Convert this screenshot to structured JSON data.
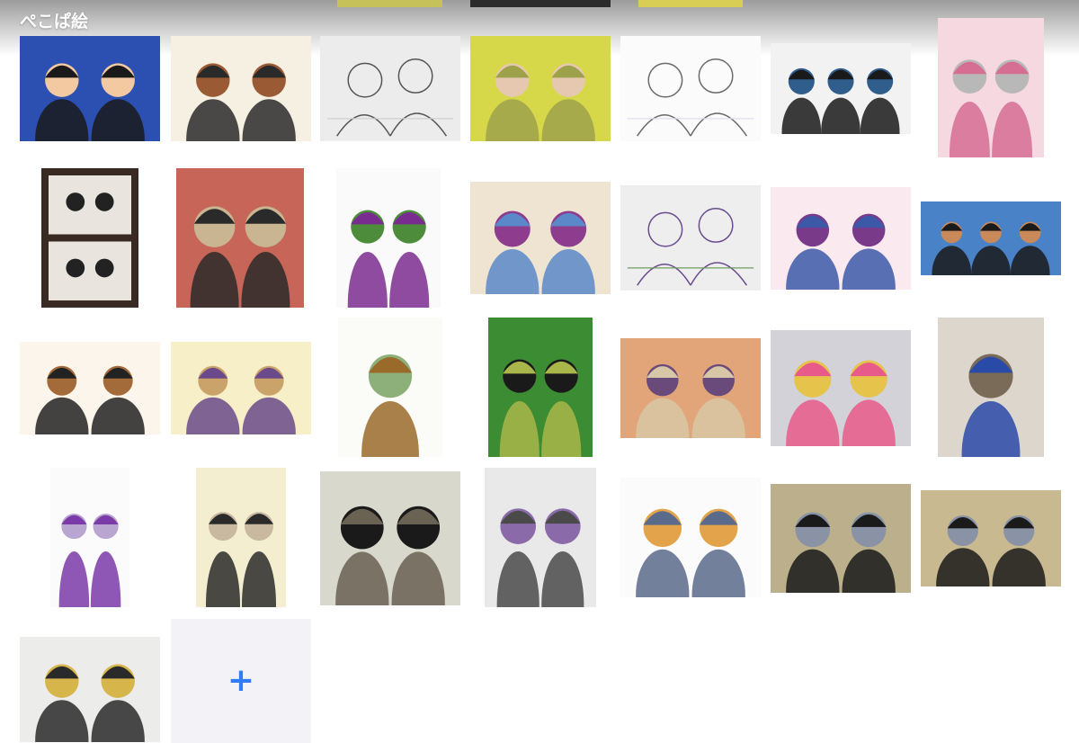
{
  "album": {
    "title": "ぺこぱ絵"
  },
  "add_tile": {
    "icon": "plus-icon",
    "accent": "#2f7cf6"
  },
  "colors": {
    "top_fade": "#9c9c9c",
    "add_tile_bg": "#f2f2f7"
  },
  "photos": [
    {
      "name": "artwork-thumbnail",
      "bg": "#2c4fb2",
      "fg": "#1a1a1a",
      "accent": "#f2c9a0",
      "motif": "duo"
    },
    {
      "name": "artwork-thumbnail",
      "bg": "#f6f0e2",
      "fg": "#2a2a2a",
      "accent": "#9a5a33",
      "motif": "duo"
    },
    {
      "name": "artwork-thumbnail",
      "bg": "#ececec",
      "fg": "#555555",
      "accent": "#cfcfcf",
      "motif": "sketch"
    },
    {
      "name": "artwork-thumbnail",
      "bg": "#d6d84a",
      "fg": "#9da24a",
      "accent": "#e6c8b0",
      "motif": "duo"
    },
    {
      "name": "artwork-thumbnail",
      "bg": "#fbfbfb",
      "fg": "#6a6a6a",
      "accent": "#e4dde8",
      "motif": "sketch"
    },
    {
      "name": "artwork-thumbnail",
      "bg": "#f2f2f2",
      "fg": "#1a1a1a",
      "accent": "#2f5d8c",
      "motif": "trio"
    },
    {
      "name": "artwork-thumbnail",
      "bg": "#f6d8e0",
      "fg": "#d66d93",
      "accent": "#b8b8b8",
      "motif": "duo"
    },
    {
      "name": "artwork-thumbnail",
      "bg": "#3a2a24",
      "fg": "#222222",
      "accent": "#e9e4de",
      "motif": "panels"
    },
    {
      "name": "artwork-thumbnail",
      "bg": "#c76558",
      "fg": "#2a2a2a",
      "accent": "#c9b592",
      "motif": "duo"
    },
    {
      "name": "artwork-thumbnail",
      "bg": "#fafafa",
      "fg": "#7a2b8f",
      "accent": "#4d8c3a",
      "motif": "duo"
    },
    {
      "name": "artwork-thumbnail",
      "bg": "#efe4d2",
      "fg": "#5b88c8",
      "accent": "#8e3d8e",
      "motif": "duo"
    },
    {
      "name": "artwork-thumbnail",
      "bg": "#eeeeee",
      "fg": "#6b4b8f",
      "accent": "#6d9a5a",
      "motif": "sketch"
    },
    {
      "name": "artwork-thumbnail",
      "bg": "#fbe9f0",
      "fg": "#3c59a8",
      "accent": "#7a3a8a",
      "motif": "duo"
    },
    {
      "name": "artwork-thumbnail",
      "bg": "#4a82c8",
      "fg": "#1a1a1a",
      "accent": "#c88a5a",
      "motif": "trio"
    },
    {
      "name": "artwork-thumbnail",
      "bg": "#fbf5ec",
      "fg": "#222222",
      "accent": "#a36a3a",
      "motif": "duo"
    },
    {
      "name": "artwork-thumbnail",
      "bg": "#f7efc8",
      "fg": "#6a4a8a",
      "accent": "#c9a36a",
      "motif": "duo"
    },
    {
      "name": "artwork-thumbnail",
      "bg": "#fbfbf7",
      "fg": "#9a6a2a",
      "accent": "#8db07a",
      "motif": "single"
    },
    {
      "name": "artwork-thumbnail",
      "bg": "#3c8c33",
      "fg": "#a8b64a",
      "accent": "#1a1a1a",
      "motif": "duo"
    },
    {
      "name": "artwork-thumbnail",
      "bg": "#e2a57a",
      "fg": "#d8c7a6",
      "accent": "#6a4a7a",
      "motif": "duo"
    },
    {
      "name": "artwork-thumbnail",
      "bg": "#d2d2d8",
      "fg": "#e85a8a",
      "accent": "#e6c34a",
      "motif": "duo"
    },
    {
      "name": "artwork-thumbnail",
      "bg": "#dcd6cc",
      "fg": "#2a4aa8",
      "accent": "#7a6a58",
      "motif": "single"
    },
    {
      "name": "artwork-thumbnail",
      "bg": "#fbfbfb",
      "fg": "#7a3aa8",
      "accent": "#b8a6d0",
      "motif": "duo"
    },
    {
      "name": "artwork-thumbnail",
      "bg": "#f3eed0",
      "fg": "#2a2a2a",
      "accent": "#c9b9a0",
      "motif": "duo"
    },
    {
      "name": "artwork-thumbnail",
      "bg": "#d8d8cc",
      "fg": "#6a6252",
      "accent": "#1a1a1a",
      "motif": "duo"
    },
    {
      "name": "artwork-thumbnail",
      "bg": "#e9e9e9",
      "fg": "#4a4a4a",
      "accent": "#8a6aa8",
      "motif": "duo"
    },
    {
      "name": "artwork-thumbnail",
      "bg": "#fbfbfb",
      "fg": "#5a6a8a",
      "accent": "#e2a34a",
      "motif": "duo"
    },
    {
      "name": "artwork-thumbnail",
      "bg": "#bcb08c",
      "fg": "#1a1a1a",
      "accent": "#8a93a6",
      "motif": "duo"
    },
    {
      "name": "artwork-thumbnail",
      "bg": "#c8b990",
      "fg": "#1a1a1a",
      "accent": "#8a93a6",
      "motif": "duo"
    },
    {
      "name": "artwork-thumbnail",
      "bg": "#ececea",
      "fg": "#2a2a2a",
      "accent": "#d6b64a",
      "motif": "duo"
    }
  ]
}
